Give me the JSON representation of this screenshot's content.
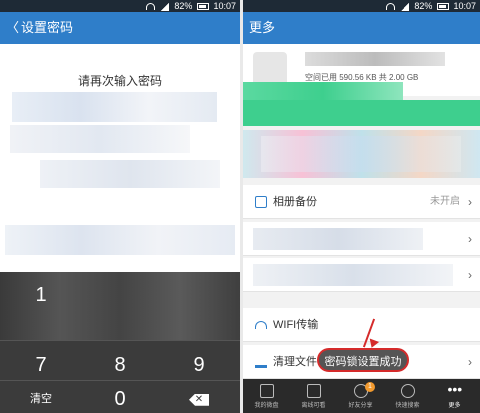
{
  "status": {
    "battery": "82%",
    "time": "10:07"
  },
  "left": {
    "title": "设置密码",
    "prompt": "请再次输入密码",
    "keys": {
      "one": "1",
      "seven": "7",
      "eight": "8",
      "nine": "9",
      "zero": "0",
      "clear": "清空",
      "delete": "✕"
    }
  },
  "right": {
    "title": "更多",
    "storage": "空间已用 590.56 KB 共 2.00 GB",
    "rows": {
      "album_label": "相册备份",
      "album_value": "未开启",
      "wifi_label": "WIFI传输",
      "clean_label": "清理文件"
    },
    "toast": "密码锁设置成功",
    "nav": [
      "我的微盘",
      "离线可看",
      "好友分享",
      "快速搜索",
      "更多"
    ],
    "nav_badge": "1"
  },
  "colors": {
    "accent": "#2f7ec9",
    "alert": "#d52b2b",
    "green": "#3ecf8e"
  }
}
